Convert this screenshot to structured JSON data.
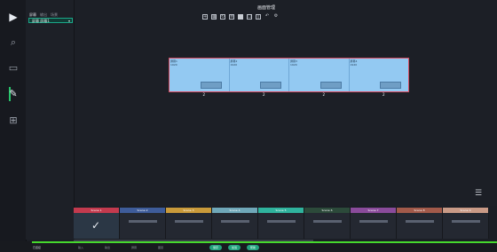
{
  "window": {
    "title": "画面管理"
  },
  "sidebar": {
    "tabs": [
      "屏幕",
      "输出",
      "场景"
    ],
    "selector_value": "屏幕  屏幕1"
  },
  "toolbar": {
    "tools": [
      "plus-square-icon",
      "grid-icon",
      "rotate-icon",
      "layers-icon",
      "picture-icon",
      "copy-icon",
      "file-icon",
      "undo-icon",
      "settings-icon"
    ]
  },
  "wall": {
    "panels": [
      {
        "label": "屏幕1",
        "sub": "1920",
        "box": "2"
      },
      {
        "label": "屏幕2",
        "sub": "1920",
        "box": "2"
      },
      {
        "label": "屏幕3",
        "sub": "1920",
        "box": "2"
      },
      {
        "label": "屏幕4",
        "sub": "1920",
        "box": "2"
      }
    ],
    "border_color": "#d64d62",
    "panel_color": "#93c9f2"
  },
  "scenes": [
    {
      "name": "Scene 1",
      "color": "#c33a4e",
      "active": true
    },
    {
      "name": "Scene 2",
      "color": "#3e5c9a",
      "active": false
    },
    {
      "name": "Scene 3",
      "color": "#c99a3a",
      "active": false
    },
    {
      "name": "Scene 4",
      "color": "#6fa7b8",
      "active": false
    },
    {
      "name": "Scene 5",
      "color": "#2fb39d",
      "active": false
    },
    {
      "name": "Scene 6",
      "color": "#2c4a3a",
      "active": false
    },
    {
      "name": "Scene 7",
      "color": "#8a4b9b",
      "active": false
    },
    {
      "name": "Scene 8",
      "color": "#a25a4a",
      "active": false
    },
    {
      "name": "Scene 9",
      "color": "#c99a86",
      "active": false
    }
  ],
  "status": {
    "left_text": "已连接",
    "items": [
      "输入",
      "输出",
      "屏幕",
      "图层"
    ],
    "pills": [
      "保存",
      "加载",
      "帮助"
    ]
  }
}
